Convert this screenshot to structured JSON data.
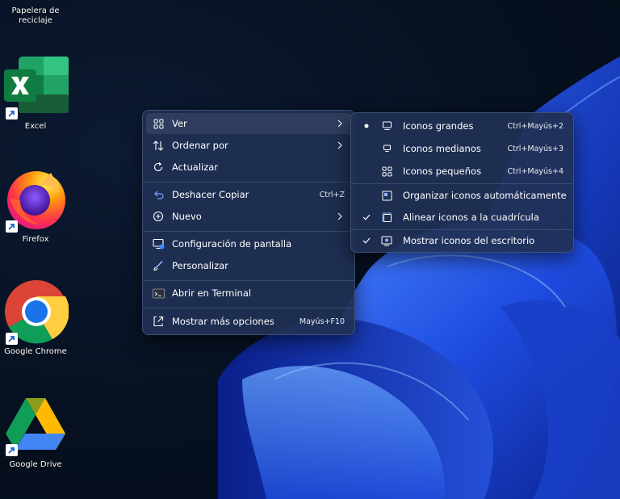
{
  "desktop_icons": [
    {
      "name": "Papelera de reciclaje",
      "icon": "recycle-bin-icon"
    },
    {
      "name": "Excel",
      "icon": "excel-icon"
    },
    {
      "name": "Firefox",
      "icon": "firefox-icon"
    },
    {
      "name": "Google Chrome",
      "icon": "chrome-icon"
    },
    {
      "name": "Google Drive",
      "icon": "google-drive-icon"
    }
  ],
  "context_menu": {
    "items": [
      {
        "label": "Ver",
        "icon": "grid-icon",
        "submenu": true
      },
      {
        "label": "Ordenar por",
        "icon": "sort-icon",
        "submenu": true
      },
      {
        "label": "Actualizar",
        "icon": "refresh-icon"
      },
      {
        "label": "Deshacer Copiar",
        "icon": "undo-icon",
        "shortcut": "Ctrl+Z"
      },
      {
        "label": "Nuevo",
        "icon": "plus-circle-icon",
        "submenu": true
      },
      {
        "label": "Configuración de pantalla",
        "icon": "display-settings-icon"
      },
      {
        "label": "Personalizar",
        "icon": "brush-icon"
      },
      {
        "label": "Abrir en Terminal",
        "icon": "terminal-icon"
      },
      {
        "label": "Mostrar más opciones",
        "icon": "more-options-icon",
        "shortcut": "Mayús+F10"
      }
    ]
  },
  "view_submenu": {
    "items": [
      {
        "label": "Iconos grandes",
        "shortcut": "Ctrl+Mayús+2",
        "selected": true,
        "icon": "monitor-large-icon"
      },
      {
        "label": "Iconos medianos",
        "shortcut": "Ctrl+Mayús+3",
        "selected": false,
        "icon": "monitor-medium-icon"
      },
      {
        "label": "Iconos pequeños",
        "shortcut": "Ctrl+Mayús+4",
        "selected": false,
        "icon": "grid-small-icon"
      },
      {
        "label": "Organizar iconos automáticamente",
        "checked": false,
        "icon": "auto-arrange-icon"
      },
      {
        "label": "Alinear iconos a la cuadrícula",
        "checked": true,
        "icon": "align-grid-icon"
      },
      {
        "label": "Mostrar iconos del escritorio",
        "checked": true,
        "icon": "show-desktop-icon"
      }
    ]
  },
  "colors": {
    "menu_background": "#203054",
    "wallpaper_blue": "#1f4fe0",
    "desktop_background": "#06101f"
  }
}
